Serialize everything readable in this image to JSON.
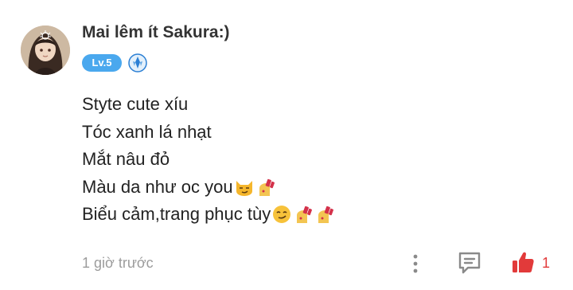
{
  "comment": {
    "username": "Mai lêm ít Sakura:)",
    "level_badge": "Lv.5",
    "lines": [
      {
        "text": "Styte cute xíu",
        "emojis": []
      },
      {
        "text": "Tóc xanh lá nhạt",
        "emojis": []
      },
      {
        "text": "Mắt nâu đỏ",
        "emojis": []
      },
      {
        "text": "Màu da như oc you",
        "emojis": [
          "smirking-cat-emoji",
          "nail-polish-emoji"
        ]
      },
      {
        "text": "Biểu cảm,trang phục tùy",
        "emojis": [
          "smirking-face-emoji",
          "nail-polish-emoji",
          "nail-polish-emoji"
        ]
      }
    ],
    "timestamp": "1 giờ trước",
    "like_count": "1"
  },
  "colors": {
    "level_badge": "#4aa8ee",
    "role_badge": "#2b7fd4",
    "like": "#e23a3a",
    "icon_gray": "#8a8a8a",
    "timestamp": "#9c9c9c"
  },
  "icons": {
    "role_badge": "staff-badge-icon",
    "more": "more-vertical-icon",
    "reply": "reply-bubble-icon",
    "like": "thumbs-up-icon"
  }
}
